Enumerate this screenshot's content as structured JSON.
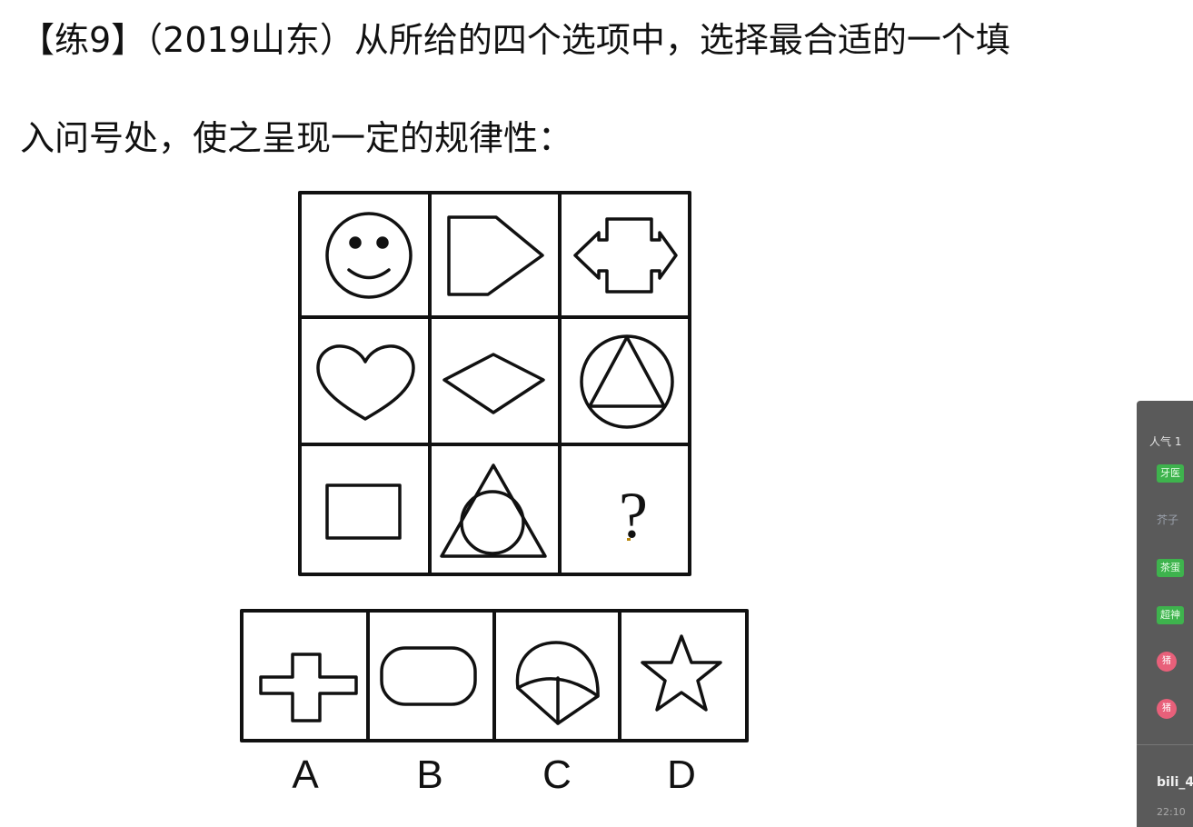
{
  "question": {
    "line1": "【练9】（2019山东）从所给的四个选项中，选择最合适的一个填",
    "line2": "入问号处，使之呈现一定的规律性："
  },
  "grid": {
    "cells": [
      {
        "shape": "smiley-face-icon"
      },
      {
        "shape": "pentagon-arrow-icon"
      },
      {
        "shape": "double-arrow-cross-icon"
      },
      {
        "shape": "heart-icon"
      },
      {
        "shape": "rhombus-icon"
      },
      {
        "shape": "triangle-in-circle-icon"
      },
      {
        "shape": "rectangle-icon"
      },
      {
        "shape": "circle-in-triangle-icon"
      },
      {
        "shape": "question-mark",
        "text": "?"
      }
    ]
  },
  "options": [
    {
      "label": "A",
      "shape": "cross-icon"
    },
    {
      "label": "B",
      "shape": "rounded-rect-icon"
    },
    {
      "label": "C",
      "shape": "dome-segment-icon"
    },
    {
      "label": "D",
      "shape": "star-icon"
    }
  ],
  "side_panel": {
    "header": "人气 1",
    "tag1": "牙医",
    "faint": "芥子",
    "tag2": "茶蛋",
    "tag3": "超神",
    "badge": "猪",
    "user": "bili_4",
    "time": "22:10"
  }
}
